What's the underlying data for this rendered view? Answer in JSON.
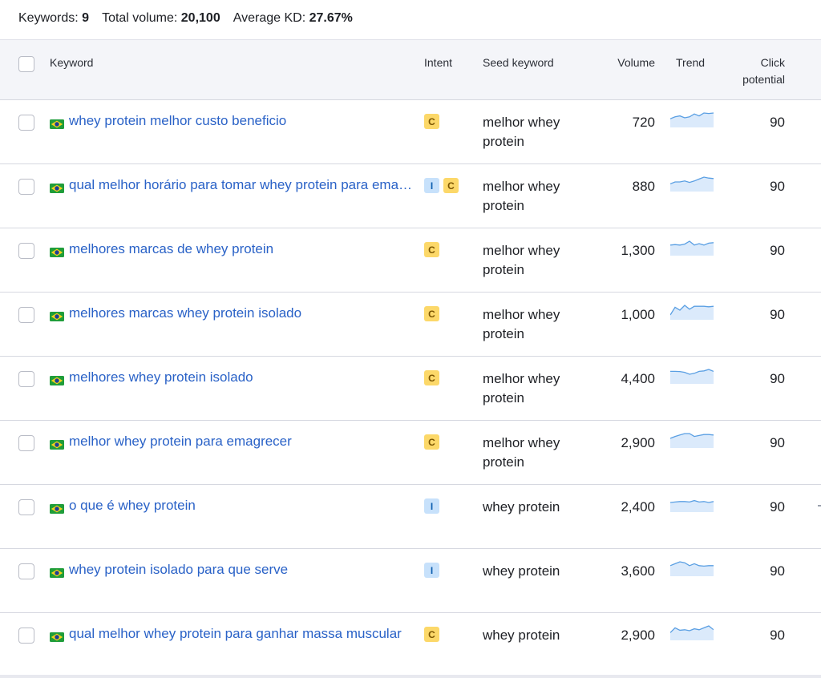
{
  "summary": {
    "keywords_label": "Keywords:",
    "keywords_value": "9",
    "volume_label": "Total volume:",
    "volume_value": "20,100",
    "kd_label": "Average KD:",
    "kd_value": "27.67%"
  },
  "columns": {
    "keyword": "Keyword",
    "intent": "Intent",
    "seed": "Seed keyword",
    "volume": "Volume",
    "trend": "Trend",
    "click_potential_line1": "Click",
    "click_potential_line2": "potential"
  },
  "colors": {
    "link": "#2a62c7",
    "intent_commercial": "#fcd869",
    "intent_informational": "#c7e1fb",
    "trend_line": "#5a9fe3",
    "trend_fill": "#dbeafb"
  },
  "rows": [
    {
      "keyword": "whey protein melhor custo beneficio",
      "intents": [
        "C"
      ],
      "seed": "melhor whey protein",
      "volume": "720",
      "trend": [
        0.4,
        0.6,
        0.7,
        0.5,
        0.6,
        0.9,
        0.7,
        1.0,
        0.95,
        1.0
      ],
      "click_potential": "90"
    },
    {
      "keyword": "qual melhor horário para tomar whey protein para emagrecer",
      "intents": [
        "I",
        "C"
      ],
      "seed": "melhor whey protein",
      "volume": "880",
      "trend": [
        0.3,
        0.5,
        0.5,
        0.6,
        0.45,
        0.6,
        0.8,
        1.0,
        0.9,
        0.85
      ],
      "click_potential": "90"
    },
    {
      "keyword": "melhores marcas de whey protein",
      "intents": [
        "C"
      ],
      "seed": "melhor whey protein",
      "volume": "1,300",
      "trend": [
        0.6,
        0.65,
        0.6,
        0.7,
        1.0,
        0.6,
        0.75,
        0.6,
        0.8,
        0.85
      ],
      "click_potential": "90"
    },
    {
      "keyword": "melhores marcas whey protein isolado",
      "intents": [
        "C"
      ],
      "seed": "melhor whey protein",
      "volume": "1,000",
      "trend": [
        0.0,
        0.8,
        0.5,
        1.0,
        0.6,
        0.9,
        0.9,
        0.9,
        0.85,
        0.9
      ],
      "click_potential": "90"
    },
    {
      "keyword": "melhores whey protein isolado",
      "intents": [
        "C"
      ],
      "seed": "melhor whey protein",
      "volume": "4,400",
      "trend": [
        0.8,
        0.8,
        0.78,
        0.7,
        0.5,
        0.6,
        0.8,
        0.85,
        1.0,
        0.8
      ],
      "click_potential": "90"
    },
    {
      "keyword": "melhor whey protein para emagrecer",
      "intents": [
        "C"
      ],
      "seed": "melhor whey protein",
      "volume": "2,900",
      "trend": [
        0.5,
        0.7,
        0.85,
        1.0,
        1.0,
        0.7,
        0.8,
        0.9,
        0.9,
        0.85
      ],
      "click_potential": "90"
    },
    {
      "keyword": "o que é whey protein",
      "intents": [
        "I"
      ],
      "seed": "whey protein",
      "volume": "2,400",
      "trend": [
        0.5,
        0.55,
        0.6,
        0.6,
        0.55,
        0.7,
        0.55,
        0.6,
        0.5,
        0.6
      ],
      "click_potential": "90"
    },
    {
      "keyword": "whey protein isolado para que serve",
      "intents": [
        "I"
      ],
      "seed": "whey protein",
      "volume": "3,600",
      "trend": [
        0.6,
        0.8,
        1.0,
        0.9,
        0.6,
        0.8,
        0.6,
        0.55,
        0.6,
        0.6
      ],
      "click_potential": "90"
    },
    {
      "keyword": "qual melhor whey protein para ganhar massa muscular",
      "intents": [
        "C"
      ],
      "seed": "whey protein",
      "volume": "2,900",
      "trend": [
        0.3,
        0.8,
        0.55,
        0.6,
        0.5,
        0.7,
        0.6,
        0.8,
        1.0,
        0.6
      ],
      "click_potential": "90"
    }
  ]
}
